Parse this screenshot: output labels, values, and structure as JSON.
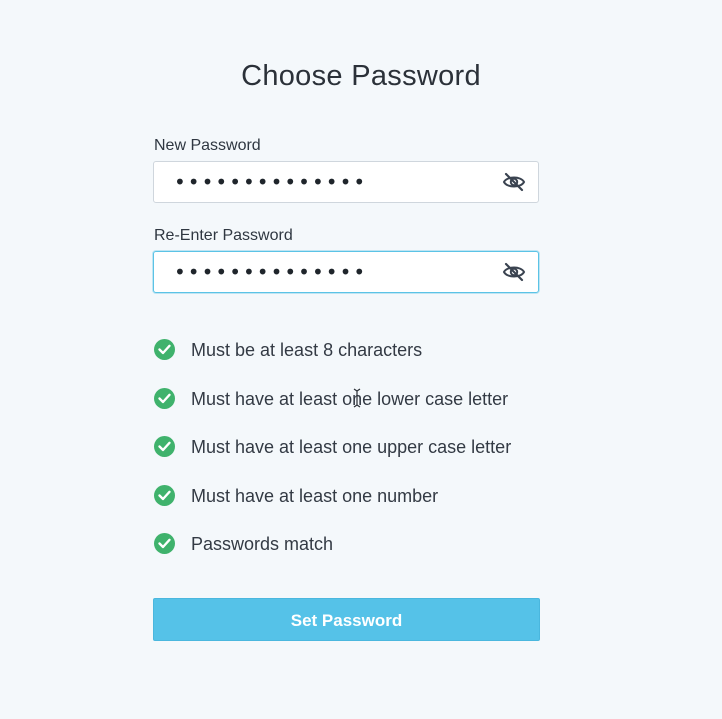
{
  "page": {
    "title": "Choose Password"
  },
  "form": {
    "new_password": {
      "label": "New Password",
      "value": "••••••••••••••"
    },
    "reenter_password": {
      "label": "Re-Enter Password",
      "value": "••••••••••••••"
    },
    "toggle_icon": "eye-slash-icon"
  },
  "requirements": [
    {
      "text": "Must be at least 8 characters",
      "met": true
    },
    {
      "text": "Must have at least one lower case letter",
      "met": true
    },
    {
      "text": "Must have at least one upper case letter",
      "met": true
    },
    {
      "text": "Must have at least one number",
      "met": true
    },
    {
      "text": "Passwords match",
      "met": true
    }
  ],
  "submit": {
    "label": "Set Password"
  },
  "colors": {
    "accent": "#55c2e8",
    "success": "#3fb26c",
    "background": "#f4f8fb"
  }
}
